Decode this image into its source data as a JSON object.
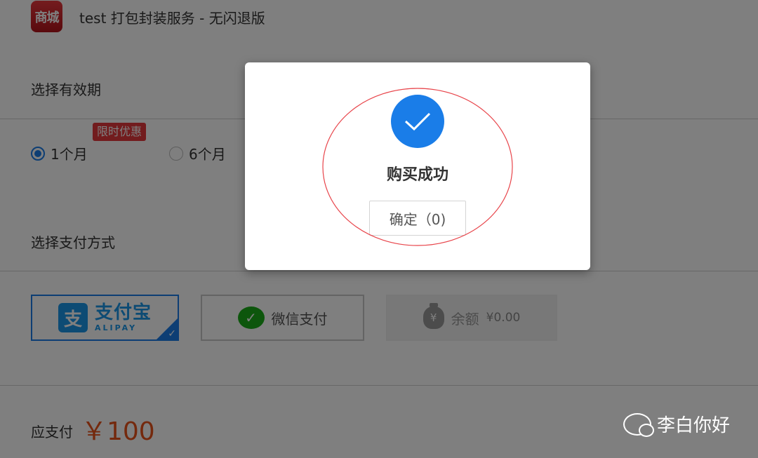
{
  "header": {
    "app_icon_text": "商城",
    "title": "test 打包封装服务 - 无闪退版"
  },
  "validity": {
    "label": "选择有效期",
    "promo_badge": "限时优惠",
    "options": [
      {
        "label": "1个月",
        "selected": true
      },
      {
        "label": "6个月",
        "selected": false
      }
    ]
  },
  "payment": {
    "label": "选择支付方式",
    "alipay": {
      "icon_text": "支",
      "cn": "支付宝",
      "en": "ALIPAY",
      "selected": true
    },
    "wechat": {
      "label": "微信支付"
    },
    "balance": {
      "icon_text": "¥",
      "label": "余额",
      "amount": "¥0.00",
      "disabled": true
    }
  },
  "due": {
    "label": "应支付",
    "amount": "￥100"
  },
  "modal": {
    "title": "购买成功",
    "confirm_label": "确定（0)",
    "annotation_color": "#e8444a"
  },
  "watermark": {
    "text": "李白你好"
  },
  "colors": {
    "accent": "#1a7de8",
    "price": "#e8521a",
    "badge": "#e4393c"
  }
}
